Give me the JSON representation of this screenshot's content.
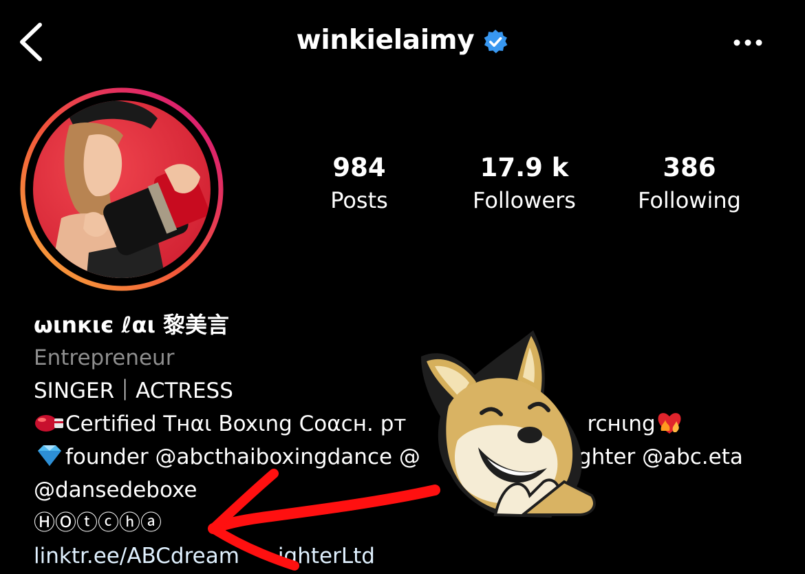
{
  "header": {
    "username": "winkielaimy",
    "verified": true,
    "back_icon": "chevron-left-icon",
    "more_icon": "more-horizontal-icon"
  },
  "stats": [
    {
      "value": "984",
      "label": "Posts"
    },
    {
      "value": "17.9 k",
      "label": "Followers"
    },
    {
      "value": "386",
      "label": "Following"
    }
  ],
  "bio": {
    "display_name": "ωιnкιє ℓαι 黎美言",
    "category": "Entrepreneur",
    "line1": "SINGER｜ACTRESS",
    "line2": "Certified Tнαι Boxιng Coαcн. pт",
    "line2_tail": "rcнιng",
    "line3": "founder @abcthaiboxingdance @",
    "line3_tail": "ghter @abc.eta",
    "line4": "@dansedeboxe",
    "line5": "ⒽⓄⓣⓒⓗⓐ",
    "link": "linktr.ee/ABCdream",
    "link_tail": "ighterLtd"
  },
  "colors": {
    "background": "#000000",
    "text": "#ffffff",
    "category": "#8e8e8e",
    "verified_badge": "#3897f0",
    "story_ring_start": "#f9b13a",
    "story_ring_end": "#d5107f",
    "annotation_arrow": "#ff1010"
  },
  "overlays": {
    "sticker": "doge-laughing-sticker",
    "annotation": "red-arrow"
  }
}
